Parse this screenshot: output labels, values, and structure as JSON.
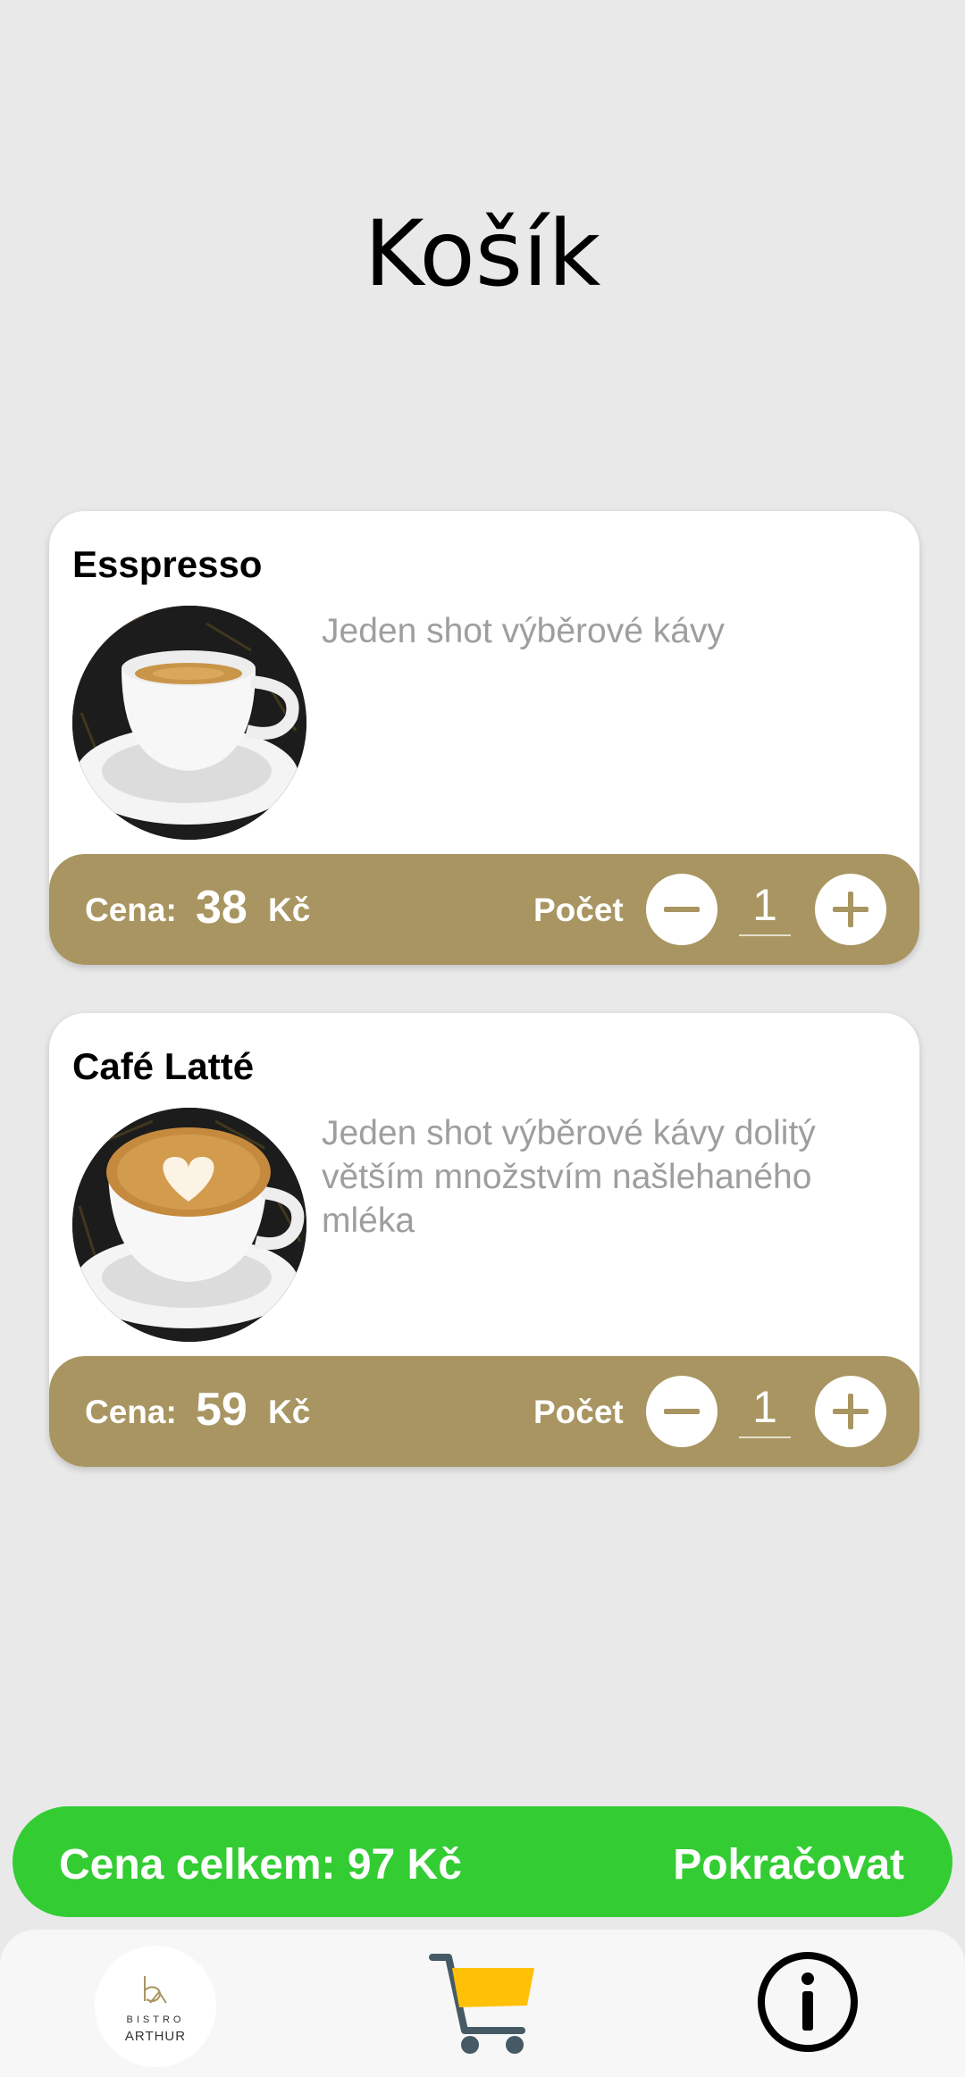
{
  "page": {
    "title": "Košík"
  },
  "cart": {
    "items": [
      {
        "name": "Esspresso",
        "description": "Jeden shot výběrové kávy",
        "price_label": "Cena:",
        "price": "38",
        "currency": "Kč",
        "quantity_label": "Počet",
        "quantity": "1",
        "photo_icon": "espresso-cup-photo"
      },
      {
        "name": "Café Latté",
        "description": "Jeden shot výběrové kávy dolitý větším množstvím našlehaného mléka",
        "price_label": "Cena:",
        "price": "59",
        "currency": "Kč",
        "quantity_label": "Počet",
        "quantity": "1",
        "photo_icon": "latte-cup-photo"
      }
    ]
  },
  "footer": {
    "total_text": "Cena celkem: 97 Kč",
    "continue_label": "Pokračovat"
  },
  "nav": {
    "logo_line1": "BISTRO",
    "logo_line2": "ARTHUR",
    "items": [
      "bistro-arthur-logo",
      "cart-icon",
      "info-icon"
    ]
  },
  "colors": {
    "background": "#e9e9e9",
    "accent_gold": "#a89561",
    "total_green": "#33cc33",
    "cart_yellow": "#ffc107",
    "cart_dark": "#455a64",
    "description_gray": "#9e9e9e"
  }
}
